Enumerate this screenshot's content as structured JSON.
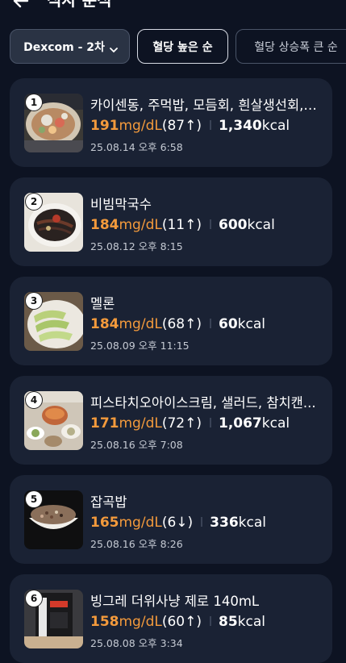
{
  "header": {
    "title": "식사 분석"
  },
  "filters": {
    "device_label": "Dexcom - 2차",
    "sort_active": "혈당 높은 순",
    "sort_alt": "혈당 상승폭 큰 순"
  },
  "meals": [
    {
      "rank": "1",
      "name": "카이센동, 주먹밥, 모듬회, 흰살생선회, ...",
      "glucose_value": "191",
      "glucose_unit": "mg/dL",
      "delta": "(87↑)",
      "kcal": "1,340",
      "kcal_unit": "kcal",
      "datetime": "25.08.14 오후 6:58"
    },
    {
      "rank": "2",
      "name": "비빔막국수",
      "glucose_value": "184",
      "glucose_unit": "mg/dL",
      "delta": "(11↑)",
      "kcal": "600",
      "kcal_unit": "kcal",
      "datetime": "25.08.12 오후 8:15"
    },
    {
      "rank": "3",
      "name": "멜론",
      "glucose_value": "184",
      "glucose_unit": "mg/dL",
      "delta": "(68↑)",
      "kcal": "60",
      "kcal_unit": "kcal",
      "datetime": "25.08.09 오후 11:15"
    },
    {
      "rank": "4",
      "name": "피스타치오아이스크림, 샐러드, 참치캔...",
      "glucose_value": "171",
      "glucose_unit": "mg/dL",
      "delta": "(72↑)",
      "kcal": "1,067",
      "kcal_unit": "kcal",
      "datetime": "25.08.16 오후 7:08"
    },
    {
      "rank": "5",
      "name": "잡곡밥",
      "glucose_value": "165",
      "glucose_unit": "mg/dL",
      "delta": "(6↓)",
      "kcal": "336",
      "kcal_unit": "kcal",
      "datetime": "25.08.16 오후 8:26"
    },
    {
      "rank": "6",
      "name": "빙그레 더위사냥 제로 140mL",
      "glucose_value": "158",
      "glucose_unit": "mg/dL",
      "delta": "(60↑)",
      "kcal": "85",
      "kcal_unit": "kcal",
      "datetime": "25.08.08 오후 3:34"
    }
  ],
  "colors": {
    "accent_glucose": "#f39a3c",
    "background": "#0d1322",
    "card": "#1a2234"
  }
}
